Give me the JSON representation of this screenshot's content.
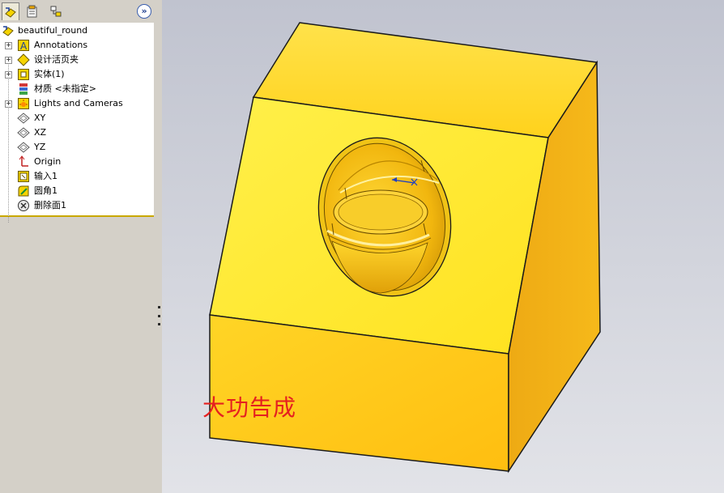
{
  "tree": {
    "root": "beautiful_round",
    "items": [
      {
        "label": "Annotations",
        "expandable": true,
        "icon": "annotations-icon"
      },
      {
        "label": "设计活页夹",
        "expandable": true,
        "icon": "design-binder-icon"
      },
      {
        "label": "实体(1)",
        "expandable": true,
        "icon": "solid-bodies-icon"
      },
      {
        "label": "材质 <未指定>",
        "expandable": false,
        "icon": "material-icon"
      },
      {
        "label": "Lights and Cameras",
        "expandable": true,
        "icon": "lights-cameras-icon"
      },
      {
        "label": "XY",
        "expandable": false,
        "icon": "plane-icon"
      },
      {
        "label": "XZ",
        "expandable": false,
        "icon": "plane-icon"
      },
      {
        "label": "YZ",
        "expandable": false,
        "icon": "plane-icon"
      },
      {
        "label": "Origin",
        "expandable": false,
        "icon": "origin-icon"
      },
      {
        "label": "输入1",
        "expandable": false,
        "icon": "imported-feature-icon"
      },
      {
        "label": "圆角1",
        "expandable": false,
        "icon": "fillet-icon"
      },
      {
        "label": "删除面1",
        "expandable": false,
        "icon": "delete-face-icon"
      }
    ]
  },
  "toolbar": {
    "tabs": [
      "feature-manager-tab",
      "property-manager-tab",
      "configuration-manager-tab"
    ],
    "expand_symbol": "»"
  },
  "viewport": {
    "caption": "大功告成",
    "model_color": "#ffd21c",
    "caption_color": "#e52020"
  }
}
